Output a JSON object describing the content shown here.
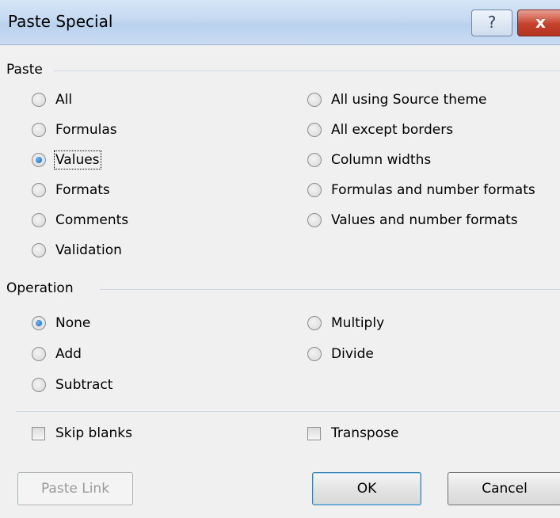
{
  "dialog": {
    "title": "Paste Special",
    "help_label": "?",
    "close_label": "x"
  },
  "paste": {
    "label": "Paste",
    "options_left": [
      {
        "label": "All",
        "checked": false
      },
      {
        "label": "Formulas",
        "checked": false
      },
      {
        "label": "Values",
        "checked": true
      },
      {
        "label": "Formats",
        "checked": false
      },
      {
        "label": "Comments",
        "checked": false
      },
      {
        "label": "Validation",
        "checked": false
      }
    ],
    "options_right": [
      {
        "label": "All using Source theme",
        "checked": false
      },
      {
        "label": "All except borders",
        "checked": false
      },
      {
        "label": "Column widths",
        "checked": false
      },
      {
        "label": "Formulas and number formats",
        "checked": false
      },
      {
        "label": "Values and number formats",
        "checked": false
      }
    ]
  },
  "operation": {
    "label": "Operation",
    "options_left": [
      {
        "label": "None",
        "checked": true
      },
      {
        "label": "Add",
        "checked": false
      },
      {
        "label": "Subtract",
        "checked": false
      }
    ],
    "options_right": [
      {
        "label": "Multiply",
        "checked": false
      },
      {
        "label": "Divide",
        "checked": false
      }
    ]
  },
  "checkboxes": {
    "skip_blanks": {
      "label": "Skip blanks",
      "checked": false
    },
    "transpose": {
      "label": "Transpose",
      "checked": false
    }
  },
  "buttons": {
    "paste_link": "Paste Link",
    "ok": "OK",
    "cancel": "Cancel"
  }
}
